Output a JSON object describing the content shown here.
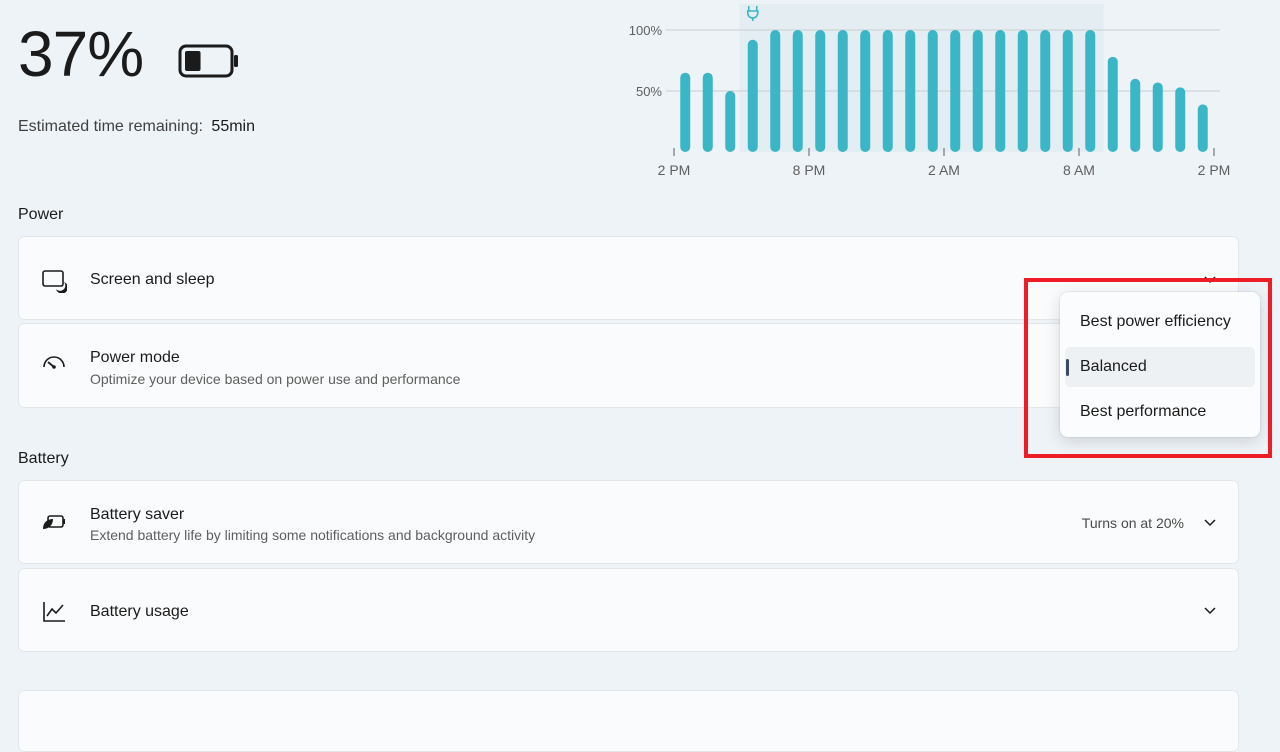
{
  "battery": {
    "percent": "37%",
    "level": 37,
    "estimate_label": "Estimated time remaining:",
    "estimate_value": "55min"
  },
  "chart_data": {
    "type": "bar",
    "ylim": [
      0,
      100
    ],
    "y_ticks": [
      "100%",
      "50%"
    ],
    "x_ticks": [
      "2 PM",
      "8 PM",
      "2 AM",
      "8 AM",
      "2 PM"
    ],
    "values": [
      65,
      65,
      50,
      92,
      100,
      100,
      100,
      100,
      100,
      100,
      100,
      100,
      100,
      100,
      100,
      100,
      100,
      100,
      100,
      78,
      60,
      57,
      53,
      39
    ],
    "charging_icon": "plug-icon",
    "bar_color": "#3bb6c6"
  },
  "power": {
    "heading": "Power",
    "screen_sleep": {
      "title": "Screen and sleep",
      "icon": "screen-sleep-icon"
    },
    "power_mode": {
      "title": "Power mode",
      "desc": "Optimize your device based on power use and performance",
      "icon": "gauge-icon",
      "options": [
        "Best power efficiency",
        "Balanced",
        "Best performance"
      ],
      "selected": "Balanced"
    }
  },
  "battery_section": {
    "heading": "Battery",
    "saver": {
      "title": "Battery saver",
      "desc": "Extend battery life by limiting some notifications and background activity",
      "status": "Turns on at 20%",
      "icon": "battery-saver-icon"
    },
    "usage": {
      "title": "Battery usage",
      "icon": "chart-line-icon"
    }
  },
  "colors": {
    "accent": "#3bb6c6",
    "highlight": "#ee1c24"
  }
}
